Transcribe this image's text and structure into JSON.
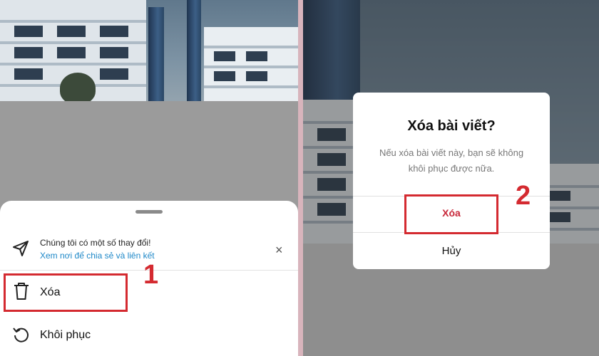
{
  "left_panel": {
    "sheet": {
      "notice_title": "Chúng tôi có một số thay đổi!",
      "notice_link": "Xem nơi để chia sẻ và liên kết",
      "close_symbol": "×",
      "items": [
        {
          "label": "Xóa",
          "icon": "trash-icon"
        },
        {
          "label": "Khôi phục",
          "icon": "restore-icon"
        }
      ]
    },
    "step_number": "1"
  },
  "right_panel": {
    "dialog": {
      "title": "Xóa bài viết?",
      "message": "Nếu xóa bài viết này, bạn sẽ không khôi phục được nữa.",
      "delete_label": "Xóa",
      "cancel_label": "Hủy"
    },
    "step_number": "2"
  },
  "colors": {
    "highlight": "#d42a30",
    "link": "#1e88c8",
    "destructive": "#c8283a"
  }
}
